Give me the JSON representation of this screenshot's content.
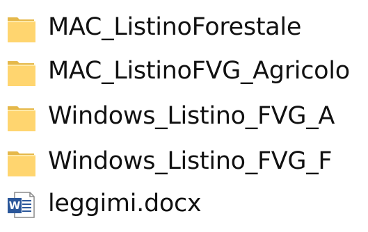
{
  "explorer": {
    "items": [
      {
        "name": "MAC_ListinoForestale",
        "type": "folder",
        "icon": "folder-icon"
      },
      {
        "name": "MAC_ListinoFVG_Agricolo",
        "type": "folder",
        "icon": "folder-icon"
      },
      {
        "name": "Windows_Listino_FVG_A",
        "type": "folder",
        "icon": "folder-icon"
      },
      {
        "name": "Windows_Listino_FVG_F",
        "type": "folder",
        "icon": "folder-icon"
      },
      {
        "name": "leggimi.docx",
        "type": "word-document",
        "icon": "word-document-icon",
        "icon_badge": "W"
      }
    ]
  },
  "colors": {
    "folder_front": "#FFD56F",
    "folder_back": "#E5B84A",
    "folder_highlight": "#FFE9A8",
    "word_blue": "#2B579A",
    "text": "#111111"
  }
}
